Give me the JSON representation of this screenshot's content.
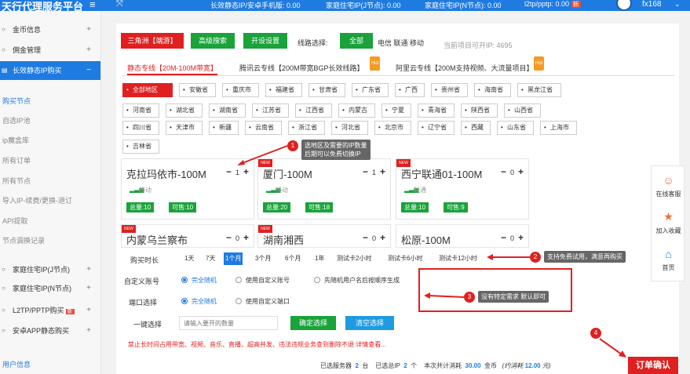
{
  "topbar": {
    "brand": "天行代理服务平台",
    "menu_icon": "≡",
    "expand_icon": "⤧",
    "stat1": "长效静态IP/安卓手机版: 0.00",
    "stat2": "家庭住宅IP(J节点): 0.00",
    "stat3": "家庭住宅IP(N节点): 0.00",
    "stat4": "l2tp/pptp: 0.00",
    "stat4_badge": "新",
    "user": "fx168",
    "caret": "⌄"
  },
  "sidebar": {
    "items": [
      {
        "label": "金币信息",
        "icon": "circle-icon",
        "glyph": "○",
        "plus": "+"
      },
      {
        "label": "佣金管理",
        "icon": "circle-icon",
        "glyph": "○",
        "plus": "+"
      },
      {
        "label": "长效静态IP购买",
        "icon": "layers-icon",
        "glyph": "▤",
        "plus": "−"
      }
    ],
    "subs": [
      "购买节点",
      "自选IP池",
      "ip魔盒库",
      "所有订单",
      "所有节点",
      "导入IP-续费/更换-退订",
      "API提取",
      "节点调换记录"
    ],
    "items2": [
      {
        "label": "家庭住宅IP(J节点)",
        "glyph": "○",
        "plus": "+"
      },
      {
        "label": "家庭住宅IP(N节点)",
        "glyph": "○",
        "plus": "+"
      },
      {
        "label": "L2TP/PPTP购买",
        "glyph": "○",
        "plus": "+",
        "tag": "新"
      },
      {
        "label": "安卓APP静态购买",
        "glyph": "○",
        "plus": "+"
      }
    ],
    "bottom": "用户信息"
  },
  "main": {
    "btn_region": "三角洲【端游】",
    "btn_advanced": "高级搜索",
    "btn_open": "开设设置",
    "route_label": "线路选择:",
    "btn_all": "全部",
    "carriers": "电信  联通  移动",
    "available": "当前项目可开IP: 4695",
    "tabs": [
      {
        "label": "静态专线【20M-100M带宽】",
        "hot": ""
      },
      {
        "label": "腾讯云专线【200M带宽BGP长效线路】",
        "hot": "Hot"
      },
      {
        "label": "阿里云专线【200M支持视频、大流量项目】",
        "hot": "Hot"
      }
    ],
    "provinces": [
      "全部地区",
      "安徽省",
      "重庆市",
      "福建省",
      "甘肃省",
      "广东省",
      "广西",
      "贵州省",
      "海南省",
      "黑龙江省",
      "河南省",
      "湖北省",
      "湖南省",
      "江苏省",
      "江西省",
      "内蒙古",
      "宁夏",
      "青海省",
      "陕西省",
      "山西省",
      "四川省",
      "天津市",
      "新疆",
      "云南省",
      "浙江省",
      "河北省",
      "北京市",
      "辽宁省",
      "西藏",
      "山东省",
      "上海市",
      "吉林省"
    ],
    "cards": [
      {
        "name": "克拉玛依市-100M",
        "qty": "1",
        "carrier": "移动",
        "total": "总量:10",
        "avail": "可售:10",
        "ribbon": ""
      },
      {
        "name": "厦门-100M",
        "qty": "1",
        "carrier": "移动",
        "total": "总量:20",
        "avail": "可售:18",
        "ribbon": "NEW"
      },
      {
        "name": "西宁联通01-100M",
        "qty": "0",
        "carrier": "联通",
        "total": "总量:10",
        "avail": "可售:9",
        "ribbon": "NEW"
      },
      {
        "name": "内蒙乌兰察布",
        "qty": "0",
        "ribbon": "NEW"
      },
      {
        "name": "湖南湘西",
        "qty": "0",
        "ribbon": "NEW"
      },
      {
        "name": "松原-100M",
        "qty": "0",
        "ribbon": ""
      }
    ],
    "minus": "−",
    "plus": "+",
    "signal": "▂▃▅",
    "duration_label": "购买时长",
    "durations": [
      "1天",
      "7天",
      "1个月",
      "3个月",
      "6个月",
      "1年",
      "测试卡2小时",
      "测试卡6小时",
      "测试卡12小时"
    ],
    "account_label": "自定义账号",
    "account_opts": [
      "完全随机",
      "使用自定义账号",
      "先随机用户名后按顺序生成"
    ],
    "port_label": "端口选择",
    "port_opts": [
      "完全随机",
      "使用自定义端口"
    ],
    "oneclick_label": "一键选择",
    "oneclick_placeholder": "请输入要开的数量",
    "btn_confirm_select": "确定选择",
    "btn_clear_select": "清空选择",
    "warning": "禁止长时间占用带宽、视频、音乐、直播、超高并发、违法违规业务查到删除不退  详情查看...",
    "summary": {
      "servers_label": "已选服务器",
      "servers": "2",
      "servers_unit": "台",
      "ips_label": "已选总IP",
      "ips": "2",
      "ips_unit": "个",
      "cost_label": "本次共计消耗",
      "cost": "30.00",
      "cost_unit": "金币",
      "approx": "(约消耗",
      "approx_val": "12.00",
      "approx_unit": "元)"
    },
    "btn_order": "订单确认"
  },
  "annotations": [
    {
      "num": "1",
      "text": "选地区及需要的IP数量\n后期可以免费切换IP"
    },
    {
      "num": "2",
      "text": "支持免费试用，满意再购买"
    },
    {
      "num": "3",
      "text": "没有特定需求 默认即可"
    },
    {
      "num": "4",
      "text": ""
    }
  ],
  "rightbar": [
    {
      "label": "在线客服",
      "icon": "support-icon",
      "glyph": "☺",
      "color": "#f07030"
    },
    {
      "label": "加入收藏",
      "icon": "star-icon",
      "glyph": "★",
      "color": "#f07030"
    },
    {
      "label": "首页",
      "icon": "home-icon",
      "glyph": "⌂",
      "color": "#1e7be1"
    }
  ],
  "colors": {
    "accent": "#1e7be1",
    "red": "#e02020",
    "green": "#19a33a"
  }
}
